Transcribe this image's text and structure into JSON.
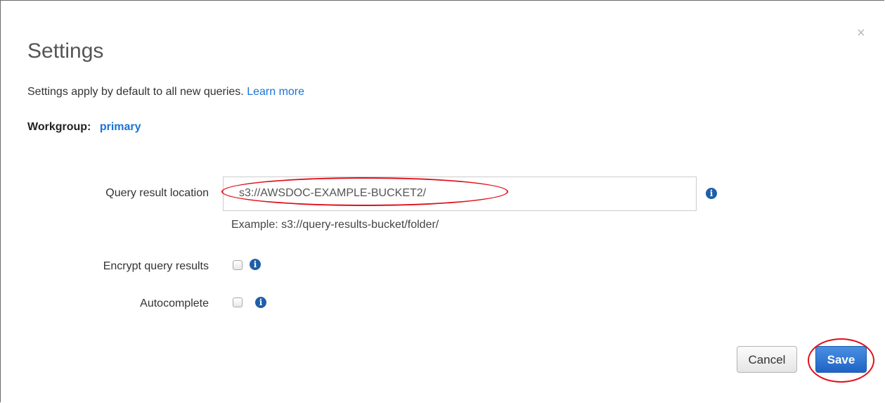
{
  "dialog": {
    "title": "Settings",
    "close_icon": "×",
    "description": "Settings apply by default to all new queries.",
    "learn_more": "Learn more",
    "workgroup_label": "Workgroup:",
    "workgroup_value": "primary"
  },
  "form": {
    "query_result_location_label": "Query result location",
    "query_result_location_value": "s3://AWSDOC-EXAMPLE-BUCKET2/",
    "query_result_location_example": "Example: s3://query-results-bucket/folder/",
    "encrypt_label": "Encrypt query results",
    "encrypt_checked": false,
    "autocomplete_label": "Autocomplete",
    "autocomplete_checked": false,
    "info_icon": "i"
  },
  "buttons": {
    "cancel": "Cancel",
    "save": "Save"
  },
  "colors": {
    "link": "#1a73d9",
    "primary_button": "#1f63c4",
    "highlight_oval": "#e0101a",
    "info_icon": "#1f5fa8"
  }
}
